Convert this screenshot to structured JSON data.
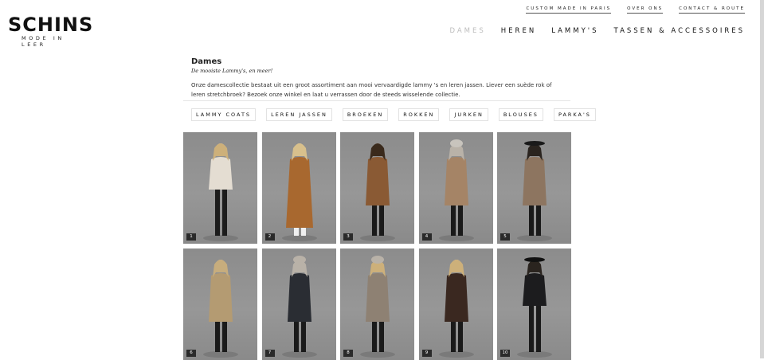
{
  "brand": {
    "name": "SCHINS",
    "tagline": "MODE IN LEER"
  },
  "top_links": [
    "CUSTOM MADE IN PARIS",
    "OVER ONS",
    "CONTACT & ROUTE"
  ],
  "nav": [
    "DAMES",
    "HEREN",
    "LAMMY'S",
    "TASSEN & ACCESSOIRES"
  ],
  "page": {
    "title": "Dames",
    "subtitle": "De mooiste Lammy's, en meer!",
    "intro": "Onze damescollectie bestaat uit een groot assortiment aan mooi vervaardigde lammy 's en leren jassen. Liever een suède rok of leren stretchbroek? Bezoek onze winkel en laat u verrassen door de steeds wisselende collectie."
  },
  "categories": [
    "LAMMY COATS",
    "LEREN JASSEN",
    "BROEKEN",
    "ROKKEN",
    "JURKEN",
    "BLOUSES",
    "PARKA'S"
  ],
  "products": [
    {
      "num": "1",
      "coat": "#e4ddd2",
      "hair": "#cdb07a",
      "legs": "#1c1c1c",
      "hat": ""
    },
    {
      "num": "2",
      "coat": "#a8682f",
      "hair": "#d8c08c",
      "legs": "#efefef",
      "hat": ""
    },
    {
      "num": "3",
      "coat": "#8a5a34",
      "hair": "#3a2a1c",
      "legs": "#1a1a1a",
      "hat": ""
    },
    {
      "num": "4",
      "coat": "#a58466",
      "hair": "#b9b2a8",
      "legs": "#1a1a1a",
      "hat": "#c8c4bd"
    },
    {
      "num": "5",
      "coat": "#8d7560",
      "hair": "#2a241f",
      "legs": "#1a1a1a",
      "hat": "#1a1a1a"
    },
    {
      "num": "6",
      "coat": "#b49b72",
      "hair": "#c7ad7d",
      "legs": "#1a1a1a",
      "hat": ""
    },
    {
      "num": "7",
      "coat": "#2a2d33",
      "hair": "#b9b2a8",
      "legs": "#1a1a1a",
      "hat": "#b9b2a8"
    },
    {
      "num": "8",
      "coat": "#8e8173",
      "hair": "#cdb07a",
      "legs": "#1a1a1a",
      "hat": "#b9b2a8"
    },
    {
      "num": "9",
      "coat": "#3a2820",
      "hair": "#cdb07a",
      "legs": "#1a1a1a",
      "hat": ""
    },
    {
      "num": "10",
      "coat": "#1c1c1e",
      "hair": "#2a241f",
      "legs": "#1a1a1a",
      "hat": "#111111"
    }
  ]
}
